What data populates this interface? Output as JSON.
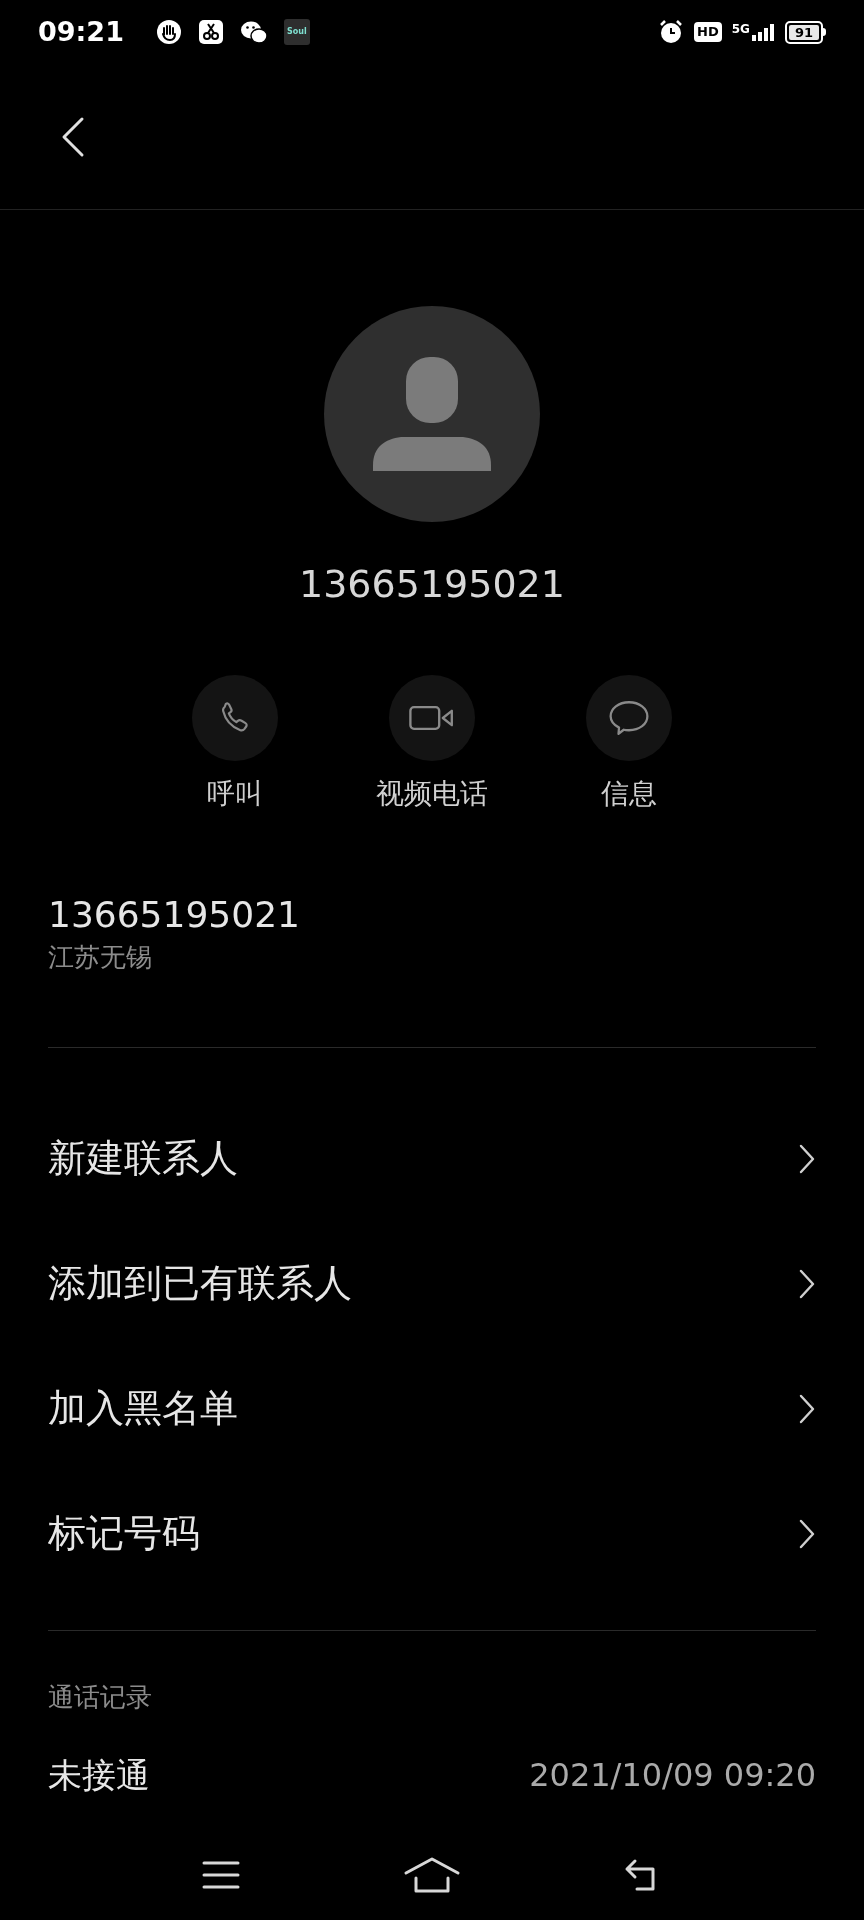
{
  "status_bar": {
    "time": "09:21",
    "app_icon_label": "Soul",
    "hd_label": "HD",
    "network": "5G",
    "battery": "91"
  },
  "contact": {
    "number": "13665195021"
  },
  "actions": [
    {
      "kind": "call",
      "label": "呼叫"
    },
    {
      "kind": "video",
      "label": "视频电话"
    },
    {
      "kind": "message",
      "label": "信息"
    }
  ],
  "number_info": {
    "number": "13665195021",
    "location": "江苏无锡"
  },
  "menu": [
    {
      "label": "新建联系人"
    },
    {
      "label": "添加到已有联系人"
    },
    {
      "label": "加入黑名单"
    },
    {
      "label": "标记号码"
    }
  ],
  "call_log": {
    "title": "通话记录",
    "entries": [
      {
        "status": "未接通",
        "time": "2021/10/09 09:20"
      }
    ]
  }
}
